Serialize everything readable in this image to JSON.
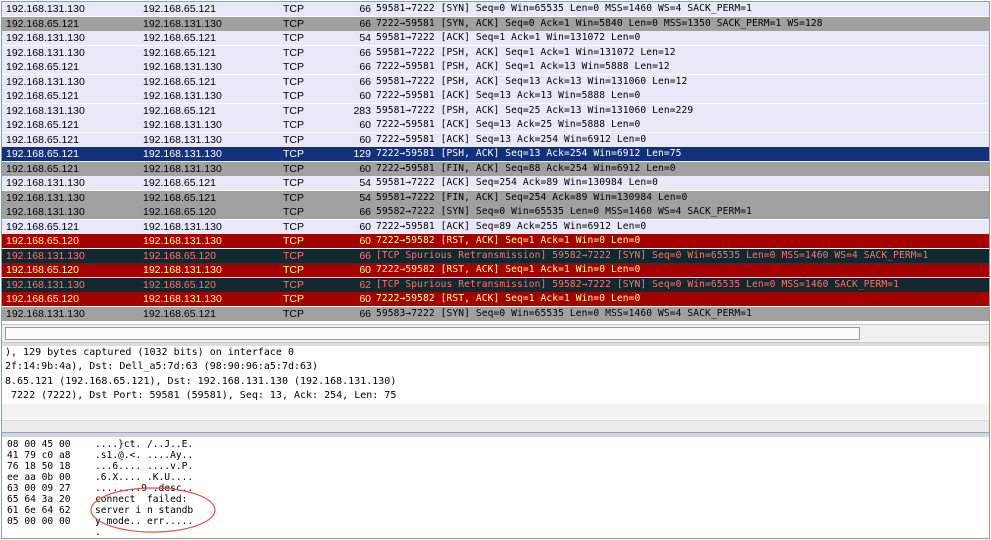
{
  "packet_list": {
    "rows": [
      {
        "style": "blue",
        "src": "192.168.131.130",
        "dst": "192.168.65.121",
        "proto": "TCP",
        "len": "66",
        "info": "59581→7222 [SYN] Seq=0 Win=65535 Len=0 MSS=1460 WS=4 SACK_PERM=1"
      },
      {
        "style": "gray",
        "src": "192.168.65.121",
        "dst": "192.168.131.130",
        "proto": "TCP",
        "len": "66",
        "info": "7222→59581 [SYN, ACK] Seq=0 Ack=1 Win=5840 Len=0 MSS=1350 SACK_PERM=1 WS=128"
      },
      {
        "style": "blue",
        "src": "192.168.131.130",
        "dst": "192.168.65.121",
        "proto": "TCP",
        "len": "54",
        "info": "59581→7222 [ACK] Seq=1 Ack=1 Win=131072 Len=0"
      },
      {
        "style": "blue",
        "src": "192.168.131.130",
        "dst": "192.168.65.121",
        "proto": "TCP",
        "len": "66",
        "info": "59581→7222 [PSH, ACK] Seq=1 Ack=1 Win=131072 Len=12"
      },
      {
        "style": "blue",
        "src": "192.168.65.121",
        "dst": "192.168.131.130",
        "proto": "TCP",
        "len": "66",
        "info": "7222→59581 [PSH, ACK] Seq=1 Ack=13 Win=5888 Len=12"
      },
      {
        "style": "blue",
        "src": "192.168.131.130",
        "dst": "192.168.65.121",
        "proto": "TCP",
        "len": "66",
        "info": "59581→7222 [PSH, ACK] Seq=13 Ack=13 Win=131060 Len=12"
      },
      {
        "style": "blue",
        "src": "192.168.65.121",
        "dst": "192.168.131.130",
        "proto": "TCP",
        "len": "60",
        "info": "7222→59581 [ACK] Seq=13 Ack=13 Win=5888 Len=0"
      },
      {
        "style": "blue",
        "src": "192.168.131.130",
        "dst": "192.168.65.121",
        "proto": "TCP",
        "len": "283",
        "info": "59581→7222 [PSH, ACK] Seq=25 Ack=13 Win=131060 Len=229"
      },
      {
        "style": "blue",
        "src": "192.168.65.121",
        "dst": "192.168.131.130",
        "proto": "TCP",
        "len": "60",
        "info": "7222→59581 [ACK] Seq=13 Ack=25 Win=5888 Len=0"
      },
      {
        "style": "blue",
        "src": "192.168.65.121",
        "dst": "192.168.131.130",
        "proto": "TCP",
        "len": "60",
        "info": "7222→59581 [ACK] Seq=13 Ack=254 Win=6912 Len=0"
      },
      {
        "style": "sel",
        "src": "192.168.65.121",
        "dst": "192.168.131.130",
        "proto": "TCP",
        "len": "129",
        "info": "7222→59581 [PSH, ACK] Seq=13 Ack=254 Win=6912 Len=75"
      },
      {
        "style": "gray",
        "src": "192.168.65.121",
        "dst": "192.168.131.130",
        "proto": "TCP",
        "len": "60",
        "info": "7222→59581 [FIN, ACK] Seq=88 Ack=254 Win=6912 Len=0"
      },
      {
        "style": "blue",
        "src": "192.168.131.130",
        "dst": "192.168.65.121",
        "proto": "TCP",
        "len": "54",
        "info": "59581→7222 [ACK] Seq=254 Ack=89 Win=130984 Len=0"
      },
      {
        "style": "gray",
        "src": "192.168.131.130",
        "dst": "192.168.65.121",
        "proto": "TCP",
        "len": "54",
        "info": "59581→7222 [FIN, ACK] Seq=254 Ack=89 Win=130984 Len=0"
      },
      {
        "style": "gray",
        "src": "192.168.131.130",
        "dst": "192.168.65.120",
        "proto": "TCP",
        "len": "66",
        "info": "59582→7222 [SYN] Seq=0 Win=65535 Len=0 MSS=1460 WS=4 SACK_PERM=1"
      },
      {
        "style": "blue",
        "src": "192.168.65.121",
        "dst": "192.168.131.130",
        "proto": "TCP",
        "len": "60",
        "info": "7222→59581 [ACK] Seq=89 Ack=255 Win=6912 Len=0"
      },
      {
        "style": "red",
        "src": "192.168.65.120",
        "dst": "192.168.131.130",
        "proto": "TCP",
        "len": "60",
        "info": "7222→59582 [RST, ACK] Seq=1 Ack=1 Win=0 Len=0"
      },
      {
        "style": "dark",
        "src": "192.168.131.130",
        "dst": "192.168.65.120",
        "proto": "TCP",
        "len": "66",
        "info": "[TCP Spurious Retransmission] 59582→7222 [SYN] Seq=0 Win=65535 Len=0 MSS=1460 WS=4 SACK_PERM=1"
      },
      {
        "style": "red",
        "src": "192.168.65.120",
        "dst": "192.168.131.130",
        "proto": "TCP",
        "len": "60",
        "info": "7222→59582 [RST, ACK] Seq=1 Ack=1 Win=0 Len=0"
      },
      {
        "style": "dark",
        "src": "192.168.131.130",
        "dst": "192.168.65.120",
        "proto": "TCP",
        "len": "62",
        "info": "[TCP Spurious Retransmission] 59582→7222 [SYN] Seq=0 Win=65535 Len=0 MSS=1460 SACK_PERM=1"
      },
      {
        "style": "red",
        "src": "192.168.65.120",
        "dst": "192.168.131.130",
        "proto": "TCP",
        "len": "60",
        "info": "7222→59582 [RST, ACK] Seq=1 Ack=1 Win=0 Len=0"
      },
      {
        "style": "gray",
        "src": "192.168.131.130",
        "dst": "192.168.65.121",
        "proto": "TCP",
        "len": "66",
        "info": "59583→7222 [SYN] Seq=0 Win=65535 Len=0 MSS=1460 WS=4 SACK_PERM=1"
      }
    ]
  },
  "details": {
    "lines": [
      "), 129 bytes captured (1032 bits) on interface 0",
      "2f:14:9b:4a), Dst: Dell_a5:7d:63 (98:90:96:a5:7d:63)",
      "8.65.121 (192.168.65.121), Dst: 192.168.131.130 (192.168.131.130)",
      " 7222 (7222), Dst Port: 59581 (59581), Seq: 13, Ack: 254, Len: 75"
    ]
  },
  "bytes": {
    "hex": [
      "08 00 45 00",
      "41 79 c0 a8",
      "76 18 50 18",
      "ee aa 0b 00",
      "63 00 09 27",
      "65 64 3a 20",
      "61 6e 64 62",
      "05 00 00 00",
      ""
    ],
    "ascii": [
      "....}ct. /..J..E.",
      ".s1.@.<. ....Ay..",
      "...6.... ....v.P.",
      ".6.X.... .K.U....",
      "........9 .desc..",
      "connect  failed:",
      "server i n standb",
      "y mode.. err.....",
      "."
    ]
  },
  "colors": {
    "selected_row": "#12317a",
    "rst_row": "#a40000",
    "retransmission_row": "#12272e",
    "highlight_circle": "#d9534f"
  }
}
